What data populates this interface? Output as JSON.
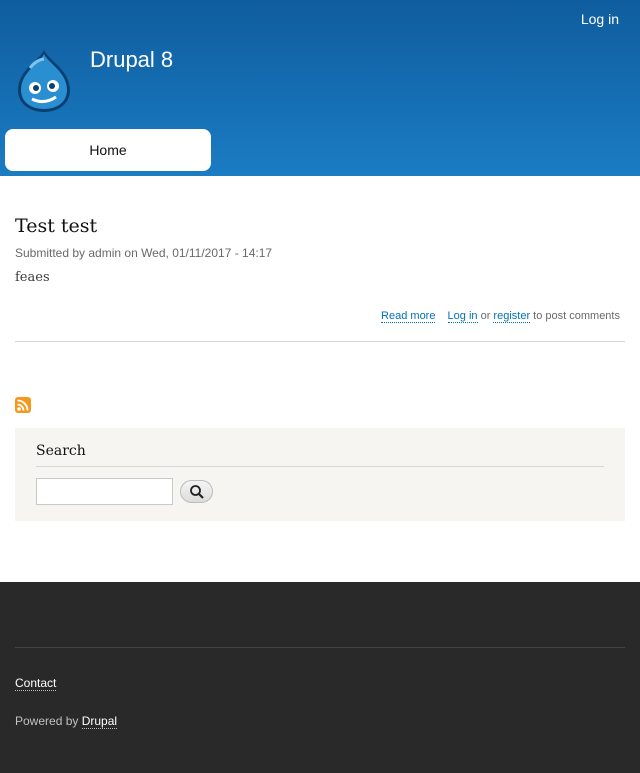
{
  "header": {
    "login_label": "Log in",
    "site_name": "Drupal 8",
    "tabs": [
      {
        "label": "Home"
      }
    ]
  },
  "node": {
    "title": "Test test",
    "submitted": "Submitted by admin on Wed, 01/11/2017 - 14:17",
    "body": "feaes",
    "links": {
      "read_more": "Read more",
      "log_in": "Log in",
      "or": "or",
      "register": "register",
      "suffix": "to post comments"
    }
  },
  "feed": {
    "icon": "rss-feed-icon"
  },
  "search": {
    "title": "Search",
    "input_value": "",
    "button_icon": "magnifier-icon"
  },
  "footer": {
    "contact": "Contact",
    "powered_prefix": "Powered by",
    "powered_link": "Drupal"
  },
  "colors": {
    "header_top": "#0f5d9e",
    "header_bottom": "#1b7cc3",
    "link": "#0071b3",
    "footer_bg": "#292929",
    "search_bg": "#f6f5f1",
    "rss": "#f39a1e"
  }
}
